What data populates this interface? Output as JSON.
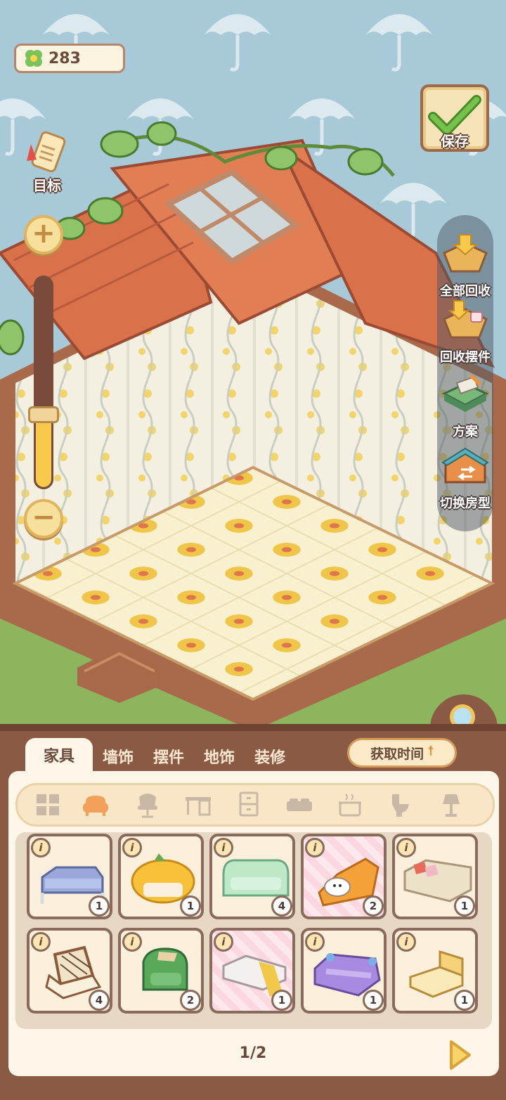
{
  "hud": {
    "currency_icon": "clover-icon",
    "currency_value": "283",
    "save_label": "保存",
    "goal_label": "目标"
  },
  "zoom": {
    "level": 0.35
  },
  "tools": [
    {
      "label": "全部回收",
      "icon": "recycle-all-icon"
    },
    {
      "label": "回收摆件",
      "icon": "recycle-ornament-icon"
    },
    {
      "label": "方案",
      "icon": "blueprint-icon"
    },
    {
      "label": "切换房型",
      "icon": "switch-room-icon"
    }
  ],
  "tabs": [
    "家具",
    "墙饰",
    "摆件",
    "地饰",
    "装修"
  ],
  "active_tab": "家具",
  "sort_label": "获取时间",
  "categories": [
    "all-grid-icon",
    "sofa-icon",
    "chair-icon",
    "desk-icon",
    "cabinet-icon",
    "bed-icon",
    "stove-icon",
    "toilet-icon",
    "lamp-icon"
  ],
  "items": [
    {
      "name": "blue-metal-sofa",
      "qty": "1"
    },
    {
      "name": "orange-pumpkin-sofa",
      "qty": "1"
    },
    {
      "name": "mint-green-sofa",
      "qty": "4"
    },
    {
      "name": "puppy-orange-armchair",
      "qty": "2"
    },
    {
      "name": "beige-sofa-with-pillows",
      "qty": "1"
    },
    {
      "name": "rattan-armchair",
      "qty": "4"
    },
    {
      "name": "green-armchair",
      "qty": "2"
    },
    {
      "name": "white-bench-with-blanket",
      "qty": "1"
    },
    {
      "name": "purple-floral-sofa",
      "qty": "1"
    },
    {
      "name": "cream-chaise",
      "qty": "1"
    }
  ],
  "pager": "1/2",
  "colors": {
    "panel": "#8a5a44",
    "accent": "#f7c84a",
    "roof": "#d9714a"
  }
}
